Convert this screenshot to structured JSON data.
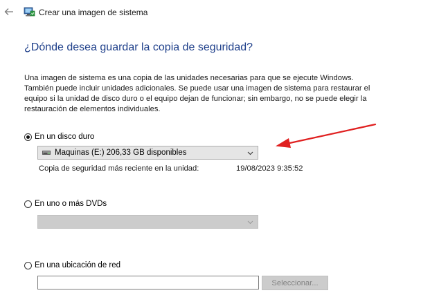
{
  "window": {
    "title": "Crear una imagen de sistema"
  },
  "icons": {
    "back": "back-arrow-icon",
    "app": "system-image-icon",
    "drive": "hard-drive-icon",
    "dropdown": "chevron-down-icon",
    "annotation": "red-arrow-annotation"
  },
  "colors": {
    "heading": "#1e3f8a",
    "annotation_arrow": "#e02020",
    "disabled_control": "#cccccc"
  },
  "main": {
    "heading": "¿Dónde desea guardar la copia de seguridad?",
    "description": [
      "Una imagen de sistema es una copia de las unidades necesarias para que se ejecute Windows.",
      "También puede incluir unidades adicionales. Se puede usar una imagen de sistema para restaurar el",
      "equipo si la unidad de disco duro o el equipo dejan de funcionar; sin embargo, no se puede elegir la",
      "restauración de elementos individuales."
    ]
  },
  "options": {
    "hard_disk": {
      "label": "En un disco duro",
      "selected": true,
      "drive_value": "Maquinas (E:)  206,33 GB disponibles",
      "last_backup_label": "Copia de seguridad más reciente en la unidad:",
      "last_backup_value": "19/08/2023 9:35:52"
    },
    "dvd": {
      "label": "En uno o más DVDs",
      "selected": false,
      "drive_value": ""
    },
    "network": {
      "label": "En una ubicación de red",
      "selected": false,
      "path_value": "",
      "select_button": "Seleccionar..."
    }
  }
}
